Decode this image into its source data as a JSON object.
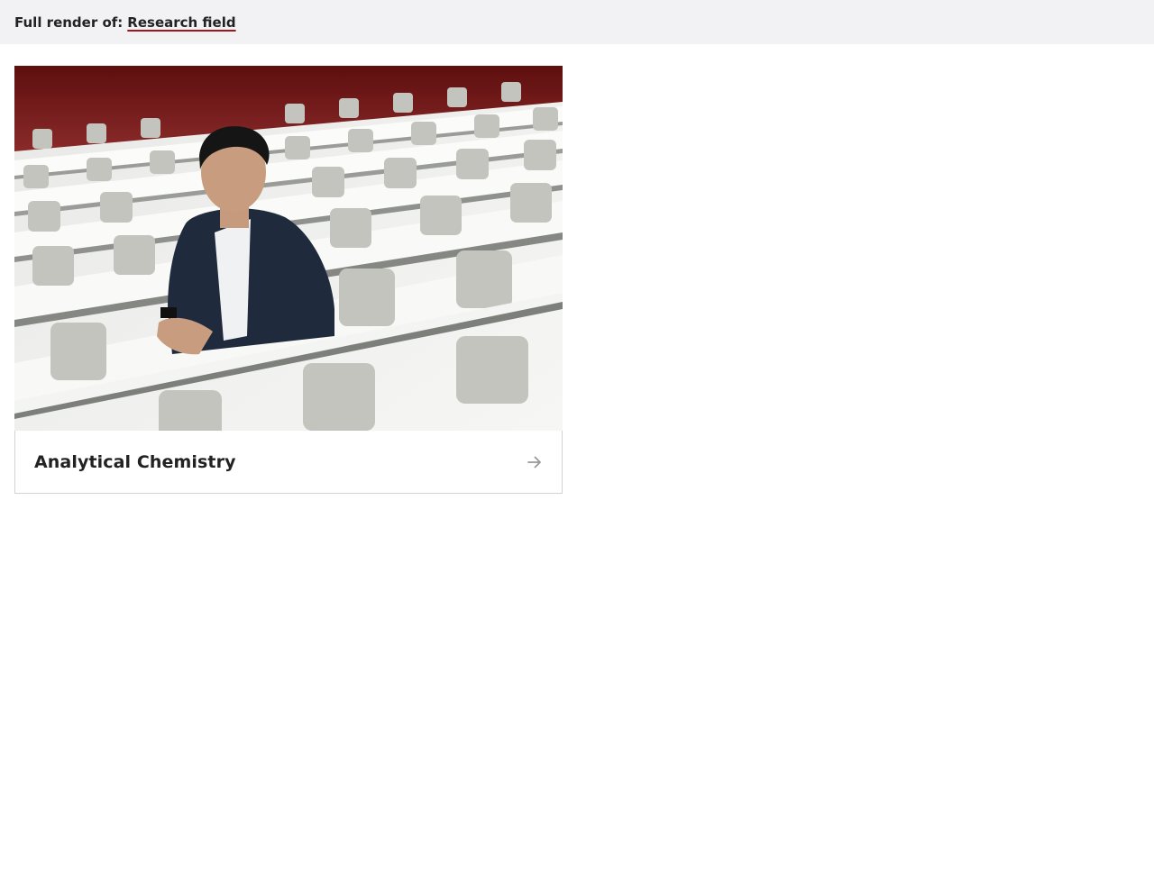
{
  "header": {
    "prefix": "Full render of:",
    "link_label": "Research field"
  },
  "card": {
    "title": "Analytical Chemistry",
    "image_icon": "photo-person-in-lecture-hall",
    "action_icon": "arrow-right-icon"
  },
  "colors": {
    "topbar_bg": "#f2f2f4",
    "link_underline": "#a4141c",
    "card_border": "#d3d3d3",
    "arrow": "#9a9a9a",
    "wall_red": "#6e1414"
  }
}
